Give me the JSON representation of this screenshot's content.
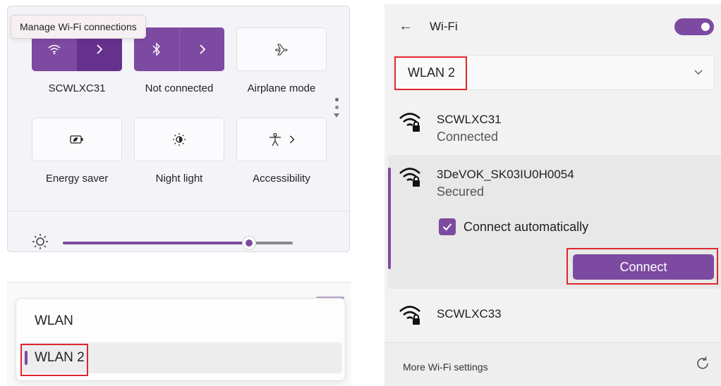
{
  "quick_settings": {
    "tooltip": "Manage Wi-Fi connections",
    "tiles": [
      {
        "label": "SCWLXC31",
        "icon": "wifi-icon",
        "active": true
      },
      {
        "label": "Not connected",
        "icon": "bluetooth-icon",
        "active": true
      },
      {
        "label": "Airplane mode",
        "icon": "airplane-icon",
        "active": false
      },
      {
        "label": "Energy saver",
        "icon": "energy-saver-icon",
        "active": false
      },
      {
        "label": "Night light",
        "icon": "night-light-icon",
        "active": false
      },
      {
        "label": "Accessibility",
        "icon": "accessibility-icon",
        "active": false
      }
    ],
    "brightness_level": 0.81
  },
  "adapter_dropdown": {
    "options": [
      "WLAN",
      "WLAN 2"
    ],
    "selected": "WLAN 2"
  },
  "wifi_panel": {
    "title": "Wi-Fi",
    "toggle_on": true,
    "adapter": "WLAN 2",
    "networks": [
      {
        "name": "SCWLXC31",
        "status": "Connected"
      },
      {
        "name": "3DeVOK_SK03IU0H0054",
        "status": "Secured",
        "expanded": true,
        "connect_auto_label": "Connect automatically",
        "connect_auto_checked": true,
        "connect_label": "Connect"
      },
      {
        "name": "SCWLXC33",
        "status": ""
      }
    ],
    "footer_link": "More Wi-Fi settings"
  },
  "colors": {
    "accent": "#7d4aa1",
    "highlight_box": "#e0262d"
  }
}
